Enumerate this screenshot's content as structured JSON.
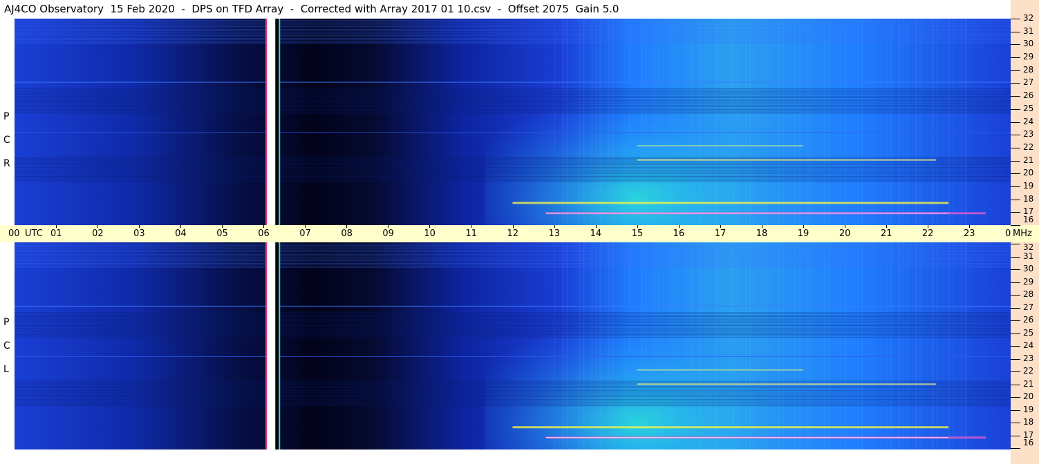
{
  "title": "AJ4CO Observatory  15 Feb 2020  -  DPS on TFD Array  -  Corrected with Array 2017 01 10.csv  -  Offset 2075  Gain 5.0",
  "chart_data": {
    "type": "heatmap",
    "title": "AJ4CO Observatory  15 Feb 2020  -  DPS on TFD Array  -  Corrected with Array 2017 01 10.csv  -  Offset 2075  Gain 5.0",
    "x_axis": {
      "unit": "UTC",
      "ticks": [
        "00",
        "01",
        "02",
        "03",
        "04",
        "05",
        "06",
        "07",
        "08",
        "09",
        "10",
        "11",
        "12",
        "13",
        "14",
        "15",
        "16",
        "17",
        "18",
        "19",
        "20",
        "21",
        "22",
        "23",
        "00"
      ]
    },
    "y_axis": {
      "unit": "MHz",
      "range": [
        16,
        32
      ],
      "ticks": [
        "32",
        "31",
        "30",
        "29",
        "28",
        "27",
        "26",
        "25",
        "24",
        "23",
        "22",
        "21",
        "20",
        "19",
        "18",
        "17",
        "16"
      ]
    },
    "panels": [
      {
        "label": "R  C  P",
        "letters": [
          "R",
          "C",
          "P"
        ]
      },
      {
        "label": "L  C  P",
        "letters": [
          "L",
          "C",
          "P"
        ]
      }
    ],
    "features": {
      "gap_utc": 6.2,
      "bright_region_utc": [
        12,
        18
      ],
      "strong_lines_mhz": [
        17.0,
        17.8,
        21.1
      ],
      "interference_line_mhz": 27.1
    },
    "colors": {
      "dark": "#02031a",
      "low": "#1a3fd6",
      "mid": "#1f7cff",
      "high": "#29e4d6",
      "peak": "#f2f24a",
      "time_strip": "#ffffcc",
      "freq_strip": "#fde0c8"
    }
  }
}
